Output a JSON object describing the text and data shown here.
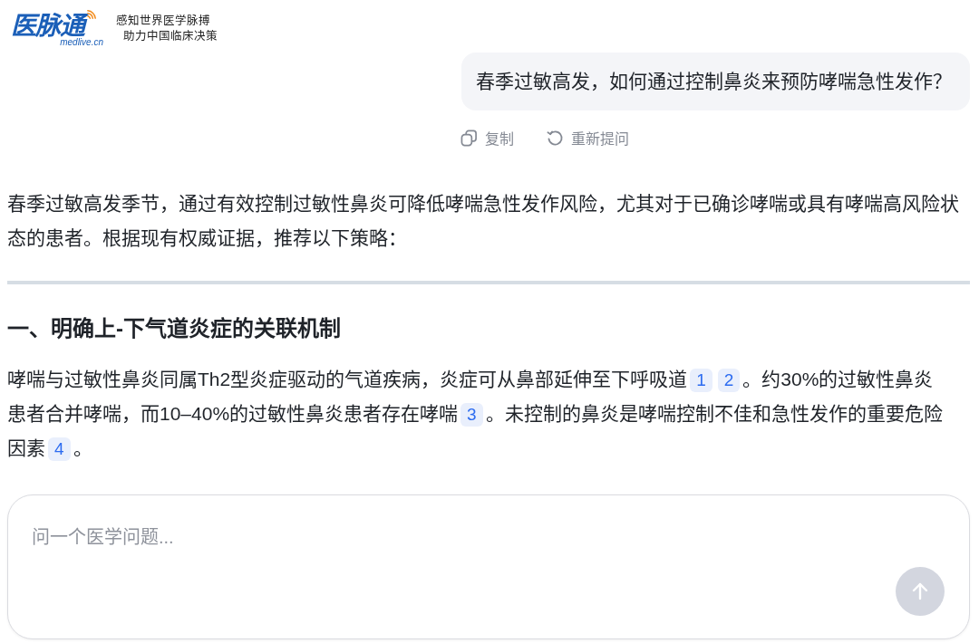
{
  "header": {
    "logo": {
      "wordmark": "医脉通",
      "domain": "medlive.cn"
    },
    "tagline": [
      "感知世界医学脉搏",
      "助力中国临床决策"
    ]
  },
  "conversation": {
    "question": "春季过敏高发，如何通过控制鼻炎来预防哮喘急性发作？",
    "actions": [
      {
        "kind": "copy",
        "label": "复制"
      },
      {
        "kind": "retry",
        "label": "重新提问"
      }
    ]
  },
  "answer": {
    "intro": "春季过敏高发季节，通过有效控制过敏性鼻炎可降低哮喘急性发作风险，尤其对于已确诊哮喘或具有哮喘高风险状态的患者。根据现有权威证据，推荐以下策略：",
    "sections": [
      {
        "heading": "一、明确上-下气道炎症的关联机制",
        "paragraphs": [
          [
            {
              "kind": "text",
              "text": "哮喘与过敏性鼻炎同属Th2型炎症驱动的气道疾病，炎症可从鼻部延伸至下呼吸道"
            },
            {
              "kind": "cite",
              "text": "1"
            },
            {
              "kind": "cite",
              "text": "2"
            },
            {
              "kind": "text",
              "text": "。约30%的过敏性鼻炎患者合并哮喘，而10–40%的过敏性鼻炎患者存在哮喘"
            },
            {
              "kind": "cite",
              "text": "3"
            },
            {
              "kind": "text",
              "text": "。未控制的鼻炎是哮喘控制不佳和急性发作的重要危险因素"
            },
            {
              "kind": "cite",
              "text": "4"
            },
            {
              "kind": "text",
              "text": "。"
            }
          ]
        ]
      }
    ]
  },
  "composer": {
    "placeholder": "问一个医学问题...",
    "send_button": {
      "disabled": true
    }
  }
}
